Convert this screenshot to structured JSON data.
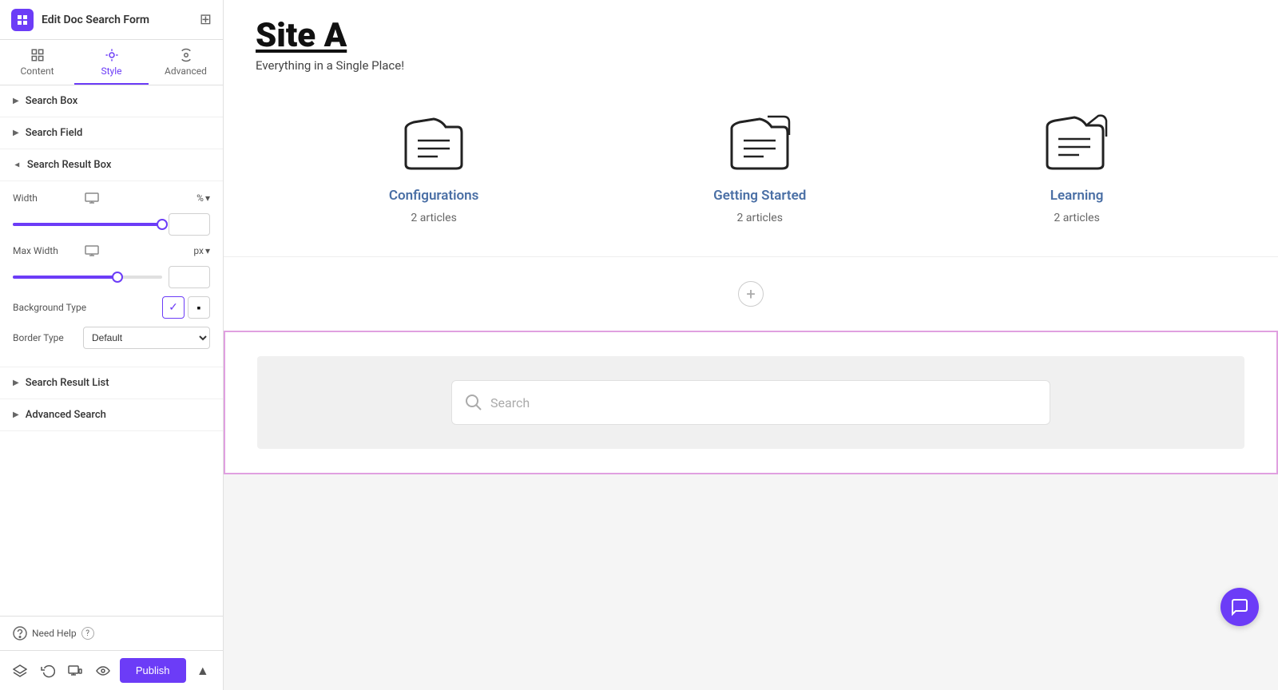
{
  "panel": {
    "title": "Edit Doc Search Form",
    "tabs": [
      {
        "id": "content",
        "label": "Content"
      },
      {
        "id": "style",
        "label": "Style"
      },
      {
        "id": "advanced",
        "label": "Advanced"
      }
    ],
    "active_tab": "style",
    "sections": {
      "search_box": {
        "label": "Search Box",
        "expanded": false
      },
      "search_field": {
        "label": "Search Field",
        "expanded": false
      },
      "search_result_box": {
        "label": "Search Result Box",
        "expanded": true,
        "width_value": "100",
        "width_unit": "%",
        "max_width_value": "1600",
        "max_width_unit": "px",
        "background_type": "gradient",
        "border_type": "Default"
      },
      "search_result_list": {
        "label": "Search Result List",
        "expanded": false
      },
      "advanced_search": {
        "label": "Advanced Search",
        "expanded": false
      }
    },
    "need_help": "Need Help",
    "bottom_tools": [
      "layers",
      "history",
      "responsive",
      "preview"
    ],
    "publish_label": "Publish"
  },
  "main": {
    "site_title": "Site A",
    "site_subtitle": "Everything in a Single Place!",
    "categories": [
      {
        "name": "Configurations",
        "count": "2 articles"
      },
      {
        "name": "Getting Started",
        "count": "2 articles"
      },
      {
        "name": "Learning",
        "count": "2 articles"
      }
    ],
    "search_placeholder": "Search"
  },
  "colors": {
    "accent": "#6c3cf7",
    "category_name": "#4a6fa5",
    "search_border": "#e0a0e0"
  }
}
